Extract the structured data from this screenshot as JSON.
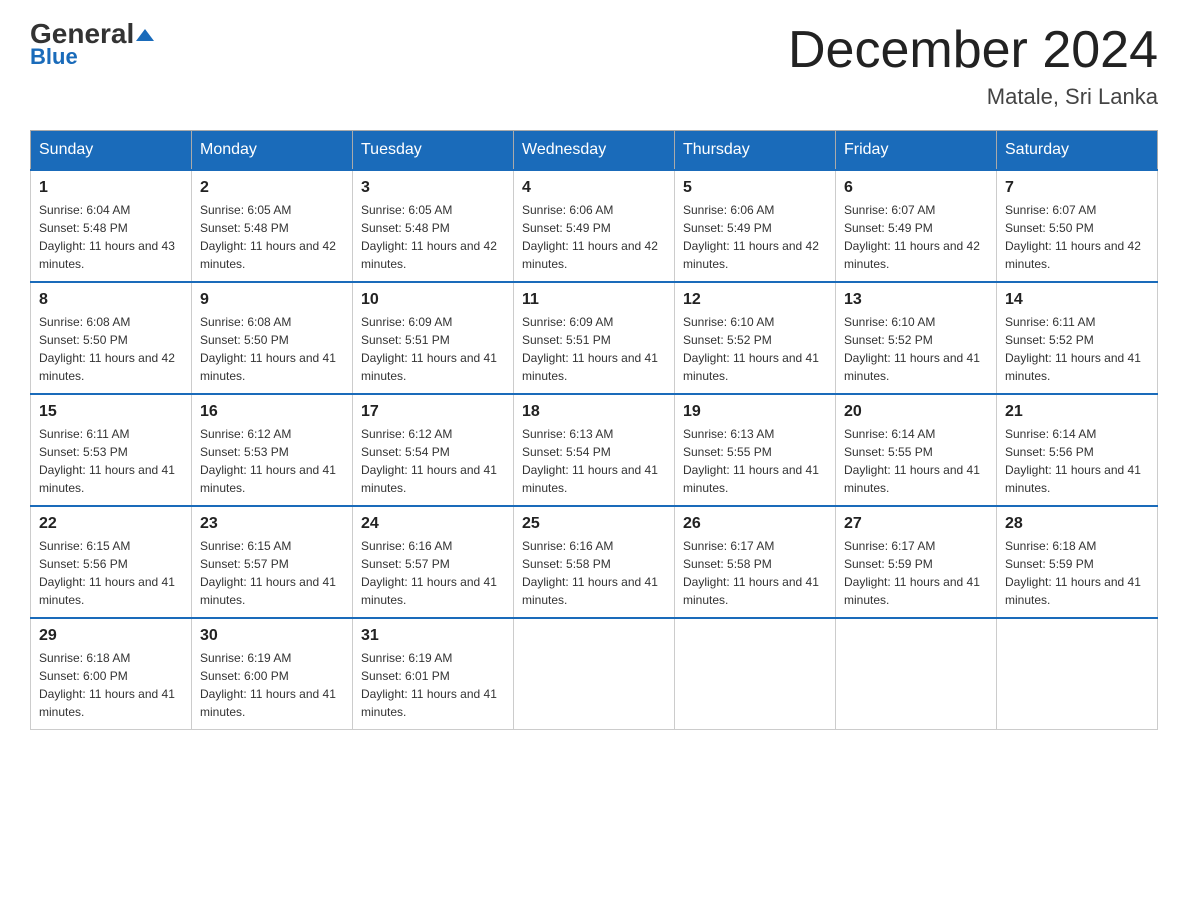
{
  "header": {
    "logo_general": "General",
    "logo_blue": "Blue",
    "main_title": "December 2024",
    "subtitle": "Matale, Sri Lanka"
  },
  "days_of_week": [
    "Sunday",
    "Monday",
    "Tuesday",
    "Wednesday",
    "Thursday",
    "Friday",
    "Saturday"
  ],
  "weeks": [
    [
      {
        "day": "1",
        "sunrise": "6:04 AM",
        "sunset": "5:48 PM",
        "daylight": "11 hours and 43 minutes."
      },
      {
        "day": "2",
        "sunrise": "6:05 AM",
        "sunset": "5:48 PM",
        "daylight": "11 hours and 42 minutes."
      },
      {
        "day": "3",
        "sunrise": "6:05 AM",
        "sunset": "5:48 PM",
        "daylight": "11 hours and 42 minutes."
      },
      {
        "day": "4",
        "sunrise": "6:06 AM",
        "sunset": "5:49 PM",
        "daylight": "11 hours and 42 minutes."
      },
      {
        "day": "5",
        "sunrise": "6:06 AM",
        "sunset": "5:49 PM",
        "daylight": "11 hours and 42 minutes."
      },
      {
        "day": "6",
        "sunrise": "6:07 AM",
        "sunset": "5:49 PM",
        "daylight": "11 hours and 42 minutes."
      },
      {
        "day": "7",
        "sunrise": "6:07 AM",
        "sunset": "5:50 PM",
        "daylight": "11 hours and 42 minutes."
      }
    ],
    [
      {
        "day": "8",
        "sunrise": "6:08 AM",
        "sunset": "5:50 PM",
        "daylight": "11 hours and 42 minutes."
      },
      {
        "day": "9",
        "sunrise": "6:08 AM",
        "sunset": "5:50 PM",
        "daylight": "11 hours and 41 minutes."
      },
      {
        "day": "10",
        "sunrise": "6:09 AM",
        "sunset": "5:51 PM",
        "daylight": "11 hours and 41 minutes."
      },
      {
        "day": "11",
        "sunrise": "6:09 AM",
        "sunset": "5:51 PM",
        "daylight": "11 hours and 41 minutes."
      },
      {
        "day": "12",
        "sunrise": "6:10 AM",
        "sunset": "5:52 PM",
        "daylight": "11 hours and 41 minutes."
      },
      {
        "day": "13",
        "sunrise": "6:10 AM",
        "sunset": "5:52 PM",
        "daylight": "11 hours and 41 minutes."
      },
      {
        "day": "14",
        "sunrise": "6:11 AM",
        "sunset": "5:52 PM",
        "daylight": "11 hours and 41 minutes."
      }
    ],
    [
      {
        "day": "15",
        "sunrise": "6:11 AM",
        "sunset": "5:53 PM",
        "daylight": "11 hours and 41 minutes."
      },
      {
        "day": "16",
        "sunrise": "6:12 AM",
        "sunset": "5:53 PM",
        "daylight": "11 hours and 41 minutes."
      },
      {
        "day": "17",
        "sunrise": "6:12 AM",
        "sunset": "5:54 PM",
        "daylight": "11 hours and 41 minutes."
      },
      {
        "day": "18",
        "sunrise": "6:13 AM",
        "sunset": "5:54 PM",
        "daylight": "11 hours and 41 minutes."
      },
      {
        "day": "19",
        "sunrise": "6:13 AM",
        "sunset": "5:55 PM",
        "daylight": "11 hours and 41 minutes."
      },
      {
        "day": "20",
        "sunrise": "6:14 AM",
        "sunset": "5:55 PM",
        "daylight": "11 hours and 41 minutes."
      },
      {
        "day": "21",
        "sunrise": "6:14 AM",
        "sunset": "5:56 PM",
        "daylight": "11 hours and 41 minutes."
      }
    ],
    [
      {
        "day": "22",
        "sunrise": "6:15 AM",
        "sunset": "5:56 PM",
        "daylight": "11 hours and 41 minutes."
      },
      {
        "day": "23",
        "sunrise": "6:15 AM",
        "sunset": "5:57 PM",
        "daylight": "11 hours and 41 minutes."
      },
      {
        "day": "24",
        "sunrise": "6:16 AM",
        "sunset": "5:57 PM",
        "daylight": "11 hours and 41 minutes."
      },
      {
        "day": "25",
        "sunrise": "6:16 AM",
        "sunset": "5:58 PM",
        "daylight": "11 hours and 41 minutes."
      },
      {
        "day": "26",
        "sunrise": "6:17 AM",
        "sunset": "5:58 PM",
        "daylight": "11 hours and 41 minutes."
      },
      {
        "day": "27",
        "sunrise": "6:17 AM",
        "sunset": "5:59 PM",
        "daylight": "11 hours and 41 minutes."
      },
      {
        "day": "28",
        "sunrise": "6:18 AM",
        "sunset": "5:59 PM",
        "daylight": "11 hours and 41 minutes."
      }
    ],
    [
      {
        "day": "29",
        "sunrise": "6:18 AM",
        "sunset": "6:00 PM",
        "daylight": "11 hours and 41 minutes."
      },
      {
        "day": "30",
        "sunrise": "6:19 AM",
        "sunset": "6:00 PM",
        "daylight": "11 hours and 41 minutes."
      },
      {
        "day": "31",
        "sunrise": "6:19 AM",
        "sunset": "6:01 PM",
        "daylight": "11 hours and 41 minutes."
      },
      null,
      null,
      null,
      null
    ]
  ]
}
